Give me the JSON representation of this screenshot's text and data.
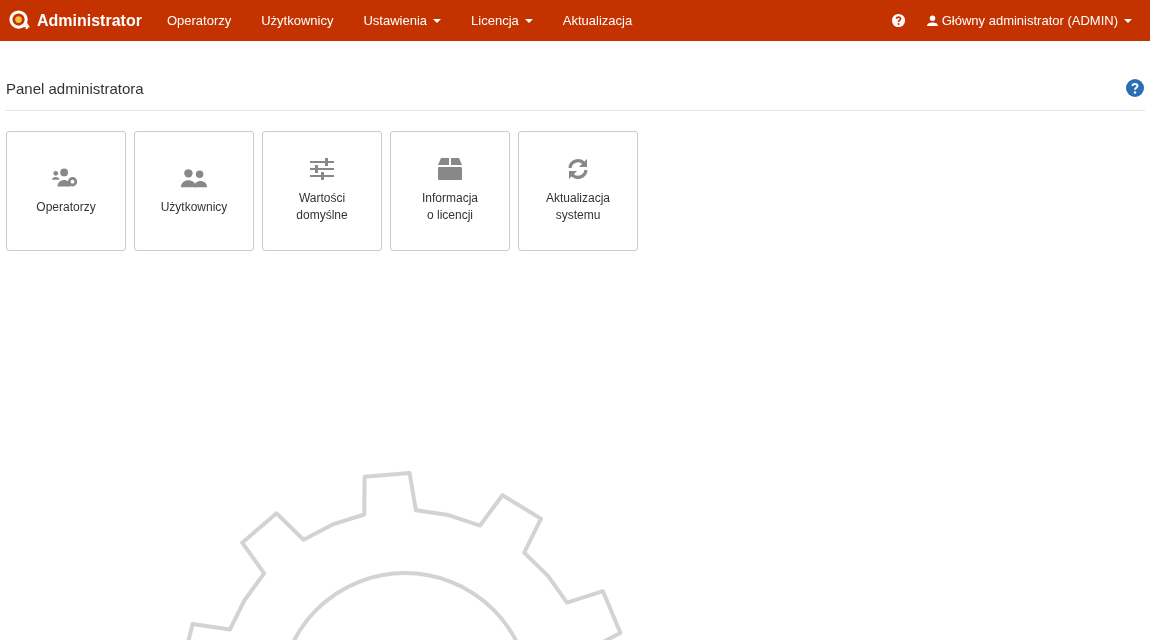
{
  "navbar": {
    "brand": "Administrator",
    "items": [
      {
        "label": "Operatorzy",
        "dropdown": false
      },
      {
        "label": "Użytkownicy",
        "dropdown": false
      },
      {
        "label": "Ustawienia",
        "dropdown": true
      },
      {
        "label": "Licencja",
        "dropdown": true
      },
      {
        "label": "Aktualizacja",
        "dropdown": false
      }
    ],
    "user": {
      "label": "Główny administrator (ADMIN)",
      "dropdown": true
    }
  },
  "page": {
    "title": "Panel administratora"
  },
  "tiles": [
    {
      "kind": "operators",
      "label": "Operatorzy"
    },
    {
      "kind": "users",
      "label": "Użytkownicy"
    },
    {
      "kind": "settings",
      "label": "Wartości\ndomyślne"
    },
    {
      "kind": "license",
      "label": "Informacja\no licencji"
    },
    {
      "kind": "update",
      "label": "Aktualizacja\nsystemu"
    }
  ]
}
